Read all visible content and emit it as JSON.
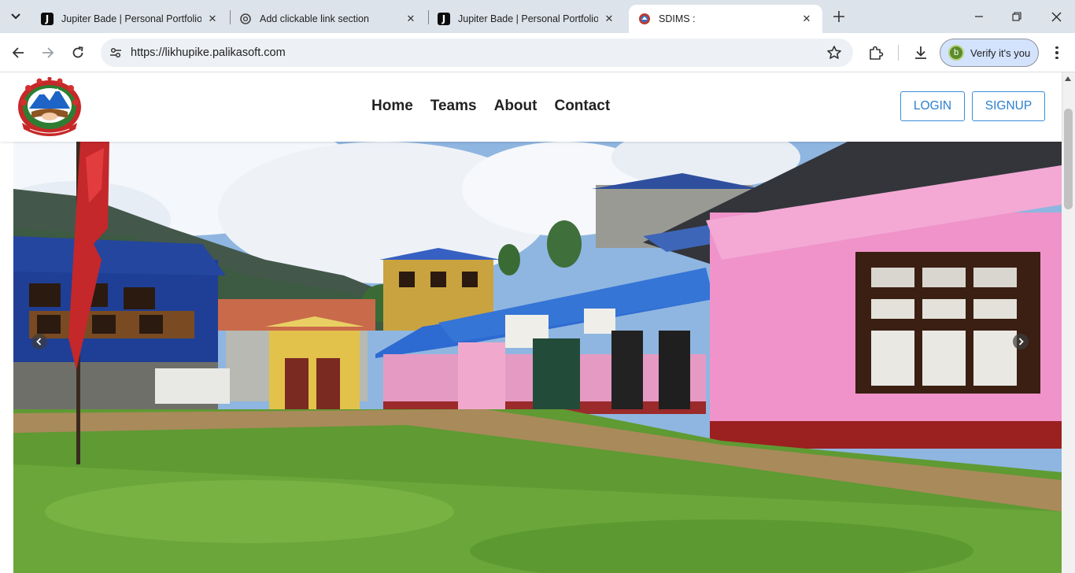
{
  "browser": {
    "tabs": [
      {
        "title": "Jupiter Bade | Personal Portfolio",
        "favicon": "j-icon",
        "active": false
      },
      {
        "title": "Add clickable link section",
        "favicon": "openai-icon",
        "active": false
      },
      {
        "title": "Jupiter Bade | Personal Portfolio",
        "favicon": "j-icon",
        "active": false
      },
      {
        "title": "SDIMS :",
        "favicon": "nepal-emblem-icon",
        "active": true
      }
    ],
    "favicon_letter": "J",
    "url": "https://likhupike.palikasoft.com",
    "profile_initial": "b",
    "verify_label": "Verify it's you"
  },
  "site": {
    "nav": {
      "home": "Home",
      "teams": "Teams",
      "about": "About",
      "contact": "Contact"
    },
    "login_label": "LOGIN",
    "signup_label": "SIGNUP"
  },
  "colors": {
    "accent": "#2a7fd0",
    "tabstrip": "#dde3ea",
    "omnibox": "#edf0f4",
    "verify_bg": "#d3e3fd"
  }
}
